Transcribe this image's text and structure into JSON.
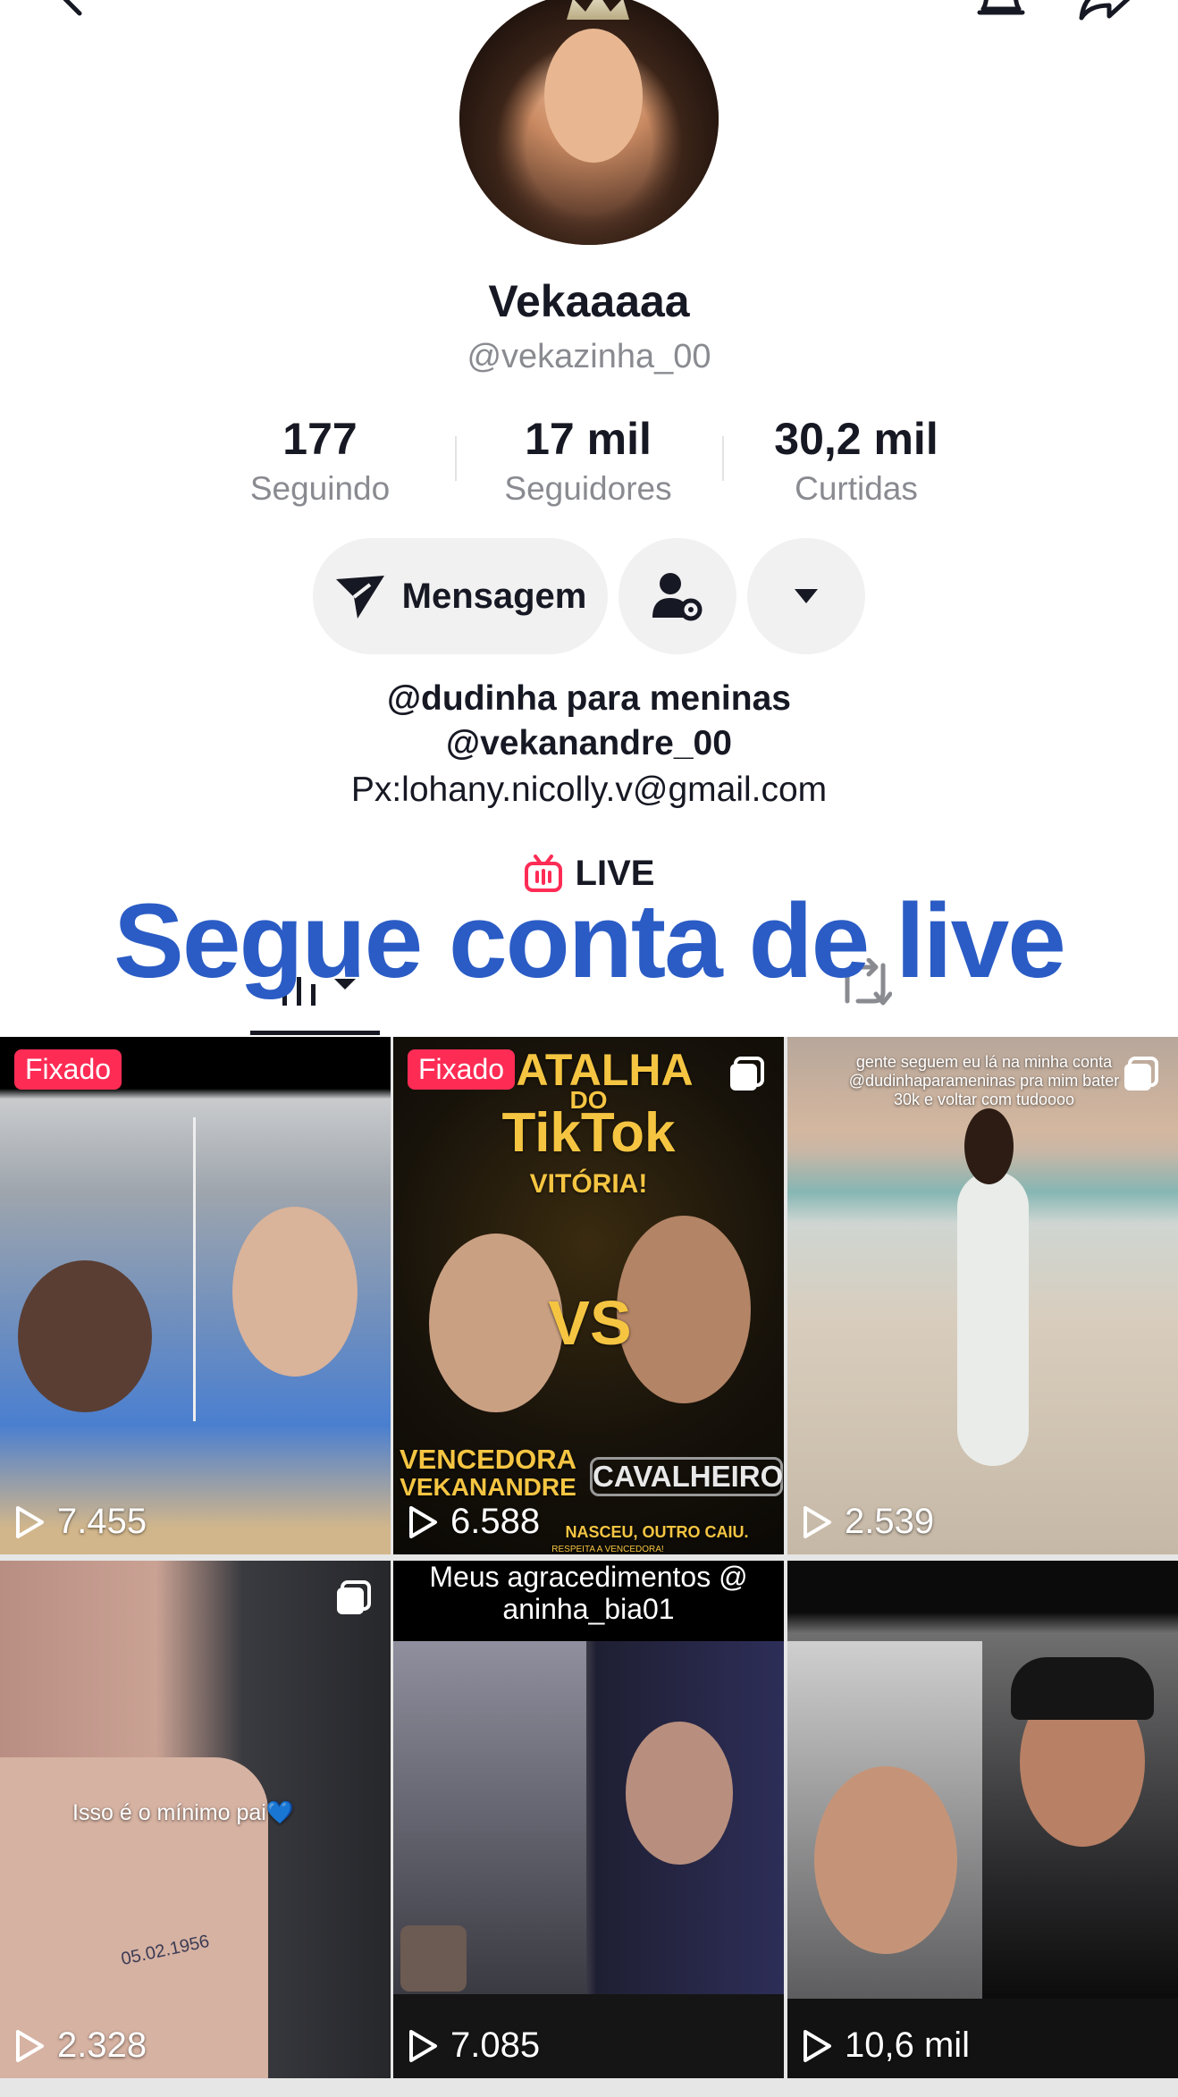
{
  "profile": {
    "display_name": "Vekaaaaa",
    "username": "@vekazinha_00"
  },
  "stats": [
    {
      "value": "177",
      "label": "Seguindo"
    },
    {
      "value": "17 mil",
      "label": "Seguidores"
    },
    {
      "value": "30,2 mil",
      "label": "Curtidas"
    }
  ],
  "actions": {
    "message_label": "Mensagem"
  },
  "bio": {
    "line1": "@dudinha para meninas",
    "line2": "@vekanandre_00",
    "line3": "Px:lohany.nicolly.v@gmail.com"
  },
  "live": {
    "label": "LIVE"
  },
  "banner": {
    "text": "Segue conta de live"
  },
  "videos": [
    {
      "views": "7.455",
      "pinned_label": "Fixado"
    },
    {
      "views": "6.588",
      "pinned_label": "Fixado",
      "overlay_lines": [
        "BATALHA",
        "DO",
        "TikTok",
        "VITÓRIA!",
        "VS",
        "VENCEDORA",
        "VEKANANDRE",
        "CAVALHEIRO",
        "NASCEU, OUTRO CAIU.",
        "RESPEITA A VENCEDORA!"
      ]
    },
    {
      "views": "2.539",
      "caption": "gente seguem eu lá na minha conta @dudinhaparameninas pra mim bater 30k e voltar com tudoooo"
    },
    {
      "views": "2.328",
      "caption": "Isso é o mínimo pai💙",
      "tattoo_text": "05.02.1956"
    },
    {
      "views": "7.085",
      "caption": "Meus agracedimentos @ aninha_bia01"
    },
    {
      "views": "10,6 mil"
    }
  ],
  "icons": {
    "back": "back-arrow-icon",
    "bell": "bell-icon",
    "share": "share-icon",
    "send": "paper-plane-icon",
    "add_friend": "user-gear-icon",
    "more": "caret-down-icon",
    "tv": "live-tv-icon",
    "grid_tab": "grid-bars-icon",
    "repost_tab": "repost-icon",
    "play": "play-icon",
    "multi": "multi-image-icon"
  },
  "colors": {
    "accent": "#fe2c55",
    "banner": "#2b5cc5",
    "secondary_text": "#8a8b91"
  }
}
